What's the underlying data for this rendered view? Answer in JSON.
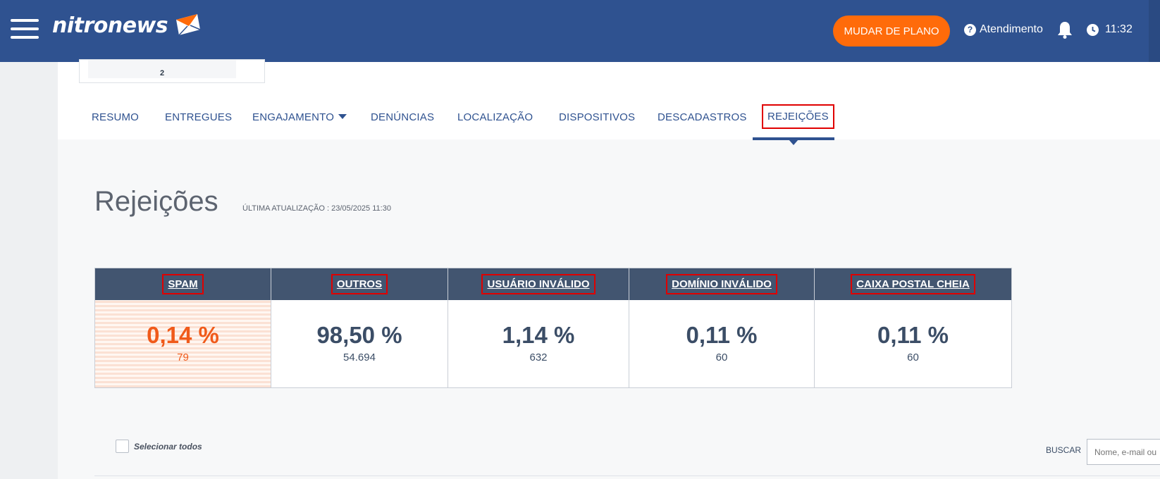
{
  "header": {
    "brand": "nitronews",
    "plan_button": "MUDAR DE PLANO",
    "support_label": "Atendimento",
    "time": "11:32"
  },
  "prev_card": {
    "value": "2"
  },
  "tabs": [
    {
      "label": "RESUMO"
    },
    {
      "label": "ENTREGUES"
    },
    {
      "label": "ENGAJAMENTO"
    },
    {
      "label": "DENÚNCIAS"
    },
    {
      "label": "LOCALIZAÇÃO"
    },
    {
      "label": "DISPOSITIVOS"
    },
    {
      "label": "DESCADASTROS"
    },
    {
      "label": "REJEIÇÕES",
      "active": true
    }
  ],
  "page": {
    "title": "Rejeições",
    "last_update": "ÚLTIMA ATUALIZAÇÃO : 23/05/2025 11:30"
  },
  "stats": [
    {
      "label": "SPAM",
      "percent": "0,14 %",
      "count": "79",
      "highlight": true
    },
    {
      "label": "OUTROS",
      "percent": "98,50 %",
      "count": "54.694"
    },
    {
      "label": "USUÁRIO INVÁLIDO",
      "percent": "1,14 %",
      "count": "632"
    },
    {
      "label": "DOMÍNIO INVÁLIDO",
      "percent": "0,11 %",
      "count": "60"
    },
    {
      "label": "CAIXA POSTAL CHEIA",
      "percent": "0,11 %",
      "count": "60"
    }
  ],
  "list": {
    "select_all": "Selecionar todos",
    "search_label": "BUSCAR",
    "search_placeholder": "Nome, e-mail ou"
  },
  "colors": {
    "header_bg": "#2f5290",
    "accent": "#ff6b0a",
    "table_head": "#425570",
    "spam": "#f05a1a",
    "highlight_box": "#e00000"
  }
}
